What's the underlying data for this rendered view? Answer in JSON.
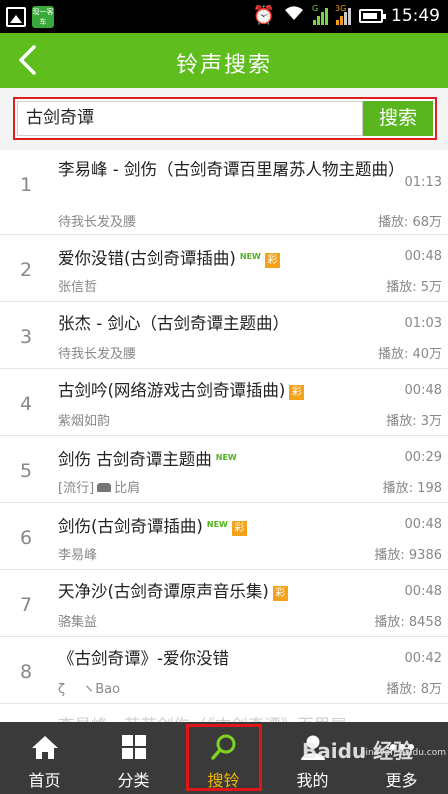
{
  "status_bar": {
    "time": "15:49",
    "app_badge": "现一客车",
    "sig1_label": "G",
    "sig2_label": "3G"
  },
  "header": {
    "title": "铃声搜索"
  },
  "search": {
    "value": "古剑奇谭",
    "button": "搜索"
  },
  "songs": [
    {
      "index": "1",
      "name": "李易峰 - 剑伤（古剑奇谭百里屠苏人物主题曲）",
      "artist": "待我长发及腰",
      "duration": "01:13",
      "plays": "播放: 68万"
    },
    {
      "index": "2",
      "name": "爱你没错(古剑奇谭插曲)",
      "new": "NEW",
      "cai": "彩",
      "artist": "张信哲",
      "duration": "00:48",
      "plays": "播放: 5万"
    },
    {
      "index": "3",
      "name": "张杰 - 剑心（古剑奇谭主题曲）",
      "artist": "待我长发及腰",
      "duration": "01:03",
      "plays": "播放: 40万"
    },
    {
      "index": "4",
      "name": "古剑吟(网络游戏古剑奇谭插曲)",
      "cai": "彩",
      "artist": "紫烟如韵",
      "duration": "00:48",
      "plays": "播放: 3万"
    },
    {
      "index": "5",
      "name": "剑伤 古剑奇谭主题曲",
      "new": "NEW",
      "artist_prefix": "[流行]",
      "artist": "比肩",
      "duration": "00:29",
      "plays": "播放: 198"
    },
    {
      "index": "6",
      "name": "剑伤(古剑奇谭插曲)",
      "new": "NEW",
      "cai": "彩",
      "artist": "李易峰",
      "duration": "00:48",
      "plays": "播放: 9386"
    },
    {
      "index": "7",
      "name": "天净沙(古剑奇谭原声音乐集)",
      "cai": "彩",
      "artist": "骆集益",
      "duration": "00:48",
      "plays": "播放: 8458"
    },
    {
      "index": "8",
      "name": "《古剑奇谭》-爱你没错",
      "artist": "ζ　 ヽBao",
      "duration": "00:42",
      "plays": "播放: 8万"
    }
  ],
  "partial_row": "李易峰 - 苏苏剑伤（《古剑奇谭》百里屠",
  "nav": [
    {
      "label": "首页",
      "icon": "home-icon"
    },
    {
      "label": "分类",
      "icon": "grid-icon"
    },
    {
      "label": "搜铃",
      "icon": "search-icon",
      "active": true
    },
    {
      "label": "我的",
      "icon": "user-icon"
    },
    {
      "label": "更多",
      "icon": "more-icon"
    }
  ],
  "watermark": {
    "brand": "Baidu 经验",
    "url": "jingyan.baidu.com"
  },
  "colors": {
    "brand_green": "#5fbe1e",
    "nav_bg": "#3a3a3a",
    "active_label": "#f7b500",
    "highlight_red": "#e02020",
    "cai_orange": "#f3a21a"
  }
}
